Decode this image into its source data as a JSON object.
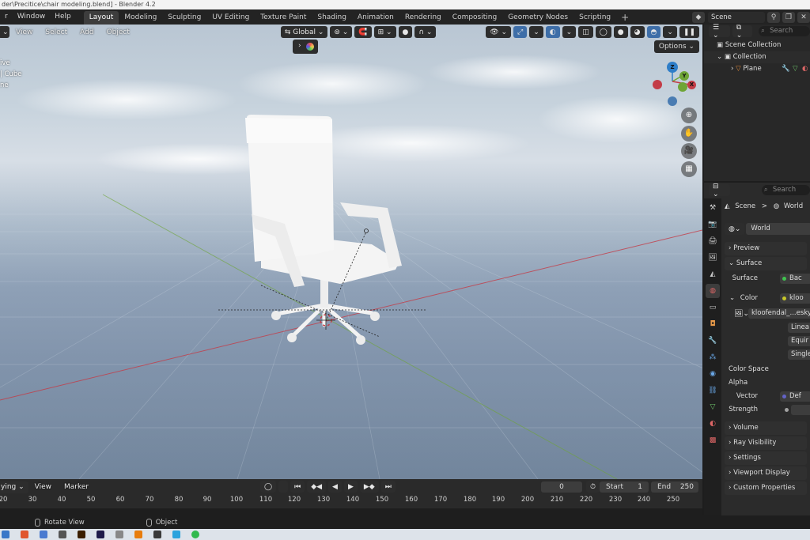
{
  "window": {
    "title": "der\\Precitice\\chair modeling.blend] - Blender 4.2"
  },
  "topbar": {
    "menus": [
      "r",
      "Window",
      "Help"
    ],
    "workspaces": [
      "Layout",
      "Modeling",
      "Sculpting",
      "UV Editing",
      "Texture Paint",
      "Shading",
      "Animation",
      "Rendering",
      "Compositing",
      "Geometry Nodes",
      "Scripting"
    ],
    "active_workspace": "Layout",
    "add_tab": "+",
    "scene_label": "Scene"
  },
  "viewport": {
    "menus": [
      "View",
      "Select",
      "Add",
      "Object"
    ],
    "transform_orientation": "Global",
    "options_label": "Options",
    "hud_lines": [
      "ive",
      "| Cube",
      "ne"
    ],
    "gizmo": {
      "z": "Z",
      "y": "Y",
      "x": "X"
    }
  },
  "timeline": {
    "menus": [
      "ying",
      "View",
      "Marker"
    ],
    "current_frame": "0",
    "start_label": "Start",
    "start_value": "1",
    "end_label": "End",
    "end_value": "250",
    "ruler": [
      "20",
      "30",
      "40",
      "50",
      "60",
      "70",
      "80",
      "90",
      "100",
      "110",
      "120",
      "130",
      "140",
      "150",
      "160",
      "170",
      "180",
      "190",
      "200",
      "210",
      "220",
      "230",
      "240",
      "250"
    ]
  },
  "statusbar": {
    "rotate_view": "Rotate View",
    "object": "Object"
  },
  "outliner": {
    "search_placeholder": "Search",
    "scene_collection": "Scene Collection",
    "collection": "Collection",
    "plane": "Plane"
  },
  "properties": {
    "search_placeholder": "Search",
    "breadcrumb_scene": "Scene",
    "breadcrumb_sep": ">",
    "breadcrumb_world": "World",
    "world_name": "World",
    "sections": {
      "preview": "Preview",
      "surface": "Surface",
      "volume": "Volume",
      "ray_visibility": "Ray Visibility",
      "settings": "Settings",
      "viewport_display": "Viewport Display",
      "custom_properties": "Custom Properties"
    },
    "surface_label": "Surface",
    "surface_value": "Bac",
    "color_label": "Color",
    "color_value": "kloo",
    "image_name": "kloofendal_...esky_",
    "linear": "Linea",
    "equirect": "Equir",
    "single": "Single",
    "color_space": "Color Space",
    "alpha": "Alpha",
    "vector_label": "Vector",
    "vector_value": "Def",
    "strength_label": "Strength"
  },
  "colors": {
    "accent": "#3e6ea8",
    "x_axis": "#c33c47",
    "y_axis": "#6ea536",
    "z_axis": "#2f7ec8"
  }
}
